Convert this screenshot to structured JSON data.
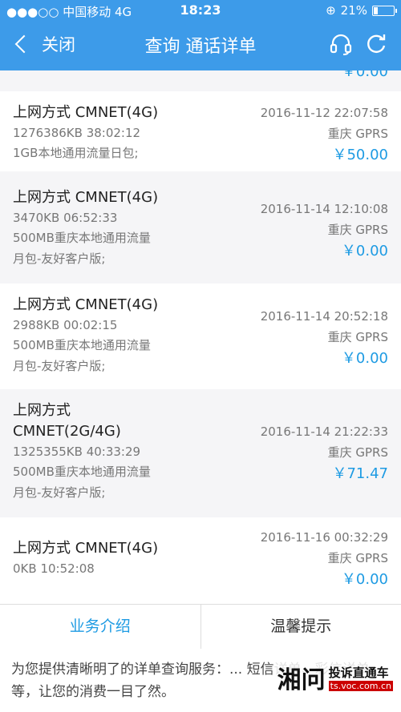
{
  "status_bar": {
    "carrier": "●●●○○ 中国移动  4G",
    "time": "18:23",
    "battery": "21%",
    "battery_level": 0.21
  },
  "nav": {
    "back_label": "关闭",
    "title": "查询 通话详单",
    "icons": [
      "headset-icon",
      "refresh-icon"
    ]
  },
  "top_partial_amount": "￥0.00",
  "records": [
    {
      "type": "上网方式 CMNET(4G)",
      "meta": "1276386KB   38:02:12",
      "package": [
        "1GB本地通用流量日包;"
      ],
      "time": "2016-11-12 22:07:58",
      "location": "重庆 GPRS",
      "amount": "￥50.00"
    },
    {
      "type": "上网方式 CMNET(4G)",
      "meta": "3470KB   06:52:33",
      "package": [
        "500MB重庆本地通用流量",
        "月包-友好客户版;"
      ],
      "time": "2016-11-14 12:10:08",
      "location": "重庆 GPRS",
      "amount": "￥0.00"
    },
    {
      "type": "上网方式 CMNET(4G)",
      "meta": "2988KB   00:02:15",
      "package": [
        "500MB重庆本地通用流量",
        "月包-友好客户版;"
      ],
      "time": "2016-11-14 20:52:18",
      "location": "重庆 GPRS",
      "amount": "￥0.00"
    },
    {
      "type": "上网方式",
      "type2": "CMNET(2G/4G)",
      "meta": "1325355KB   40:33:29",
      "package": [
        "500MB重庆本地通用流量",
        "月包-友好客户版;"
      ],
      "time": "2016-11-14 21:22:33",
      "location": "重庆 GPRS",
      "amount": "￥71.47"
    },
    {
      "type": "上网方式 CMNET(4G)",
      "meta": "0KB   10:52:08",
      "package": [],
      "time": "2016-11-16 00:32:29",
      "location": "重庆 GPRS",
      "amount": "￥0.00"
    }
  ],
  "tabs": [
    {
      "label": "业务介绍",
      "active": true
    },
    {
      "label": "温馨提示",
      "active": false
    }
  ],
  "description": "为您提供清晰明了的详单查询服务：... 短信详单、彩信详单等，让您的消费一目了然。",
  "watermark": {
    "logo": "湘问",
    "title": "投诉直通车",
    "url": "ts.voc.com.cn"
  },
  "colors": {
    "header": "#3d9be9",
    "accent": "#1e9be3"
  }
}
